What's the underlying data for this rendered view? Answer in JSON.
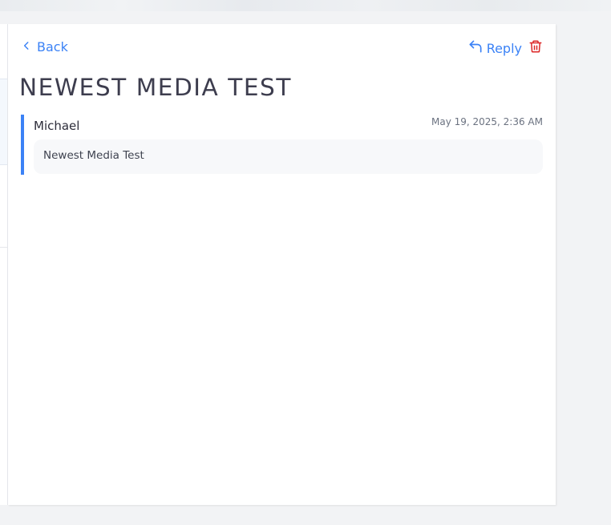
{
  "nav": {
    "back_label": "Back"
  },
  "actions": {
    "reply_label": "Reply"
  },
  "thread": {
    "title": "NEWEST MEDIA TEST"
  },
  "messages": [
    {
      "sender": "Michael",
      "timestamp": "May 19, 2025, 2:36 AM",
      "body": "Newest Media Test"
    }
  ],
  "colors": {
    "accent": "#3b82f6",
    "danger": "#dc2626",
    "title": "#3d3d4e",
    "background": "#f2f3f5"
  },
  "icons": {
    "back": "chevron-left-icon",
    "reply": "reply-arrow-icon",
    "delete": "trash-icon"
  }
}
